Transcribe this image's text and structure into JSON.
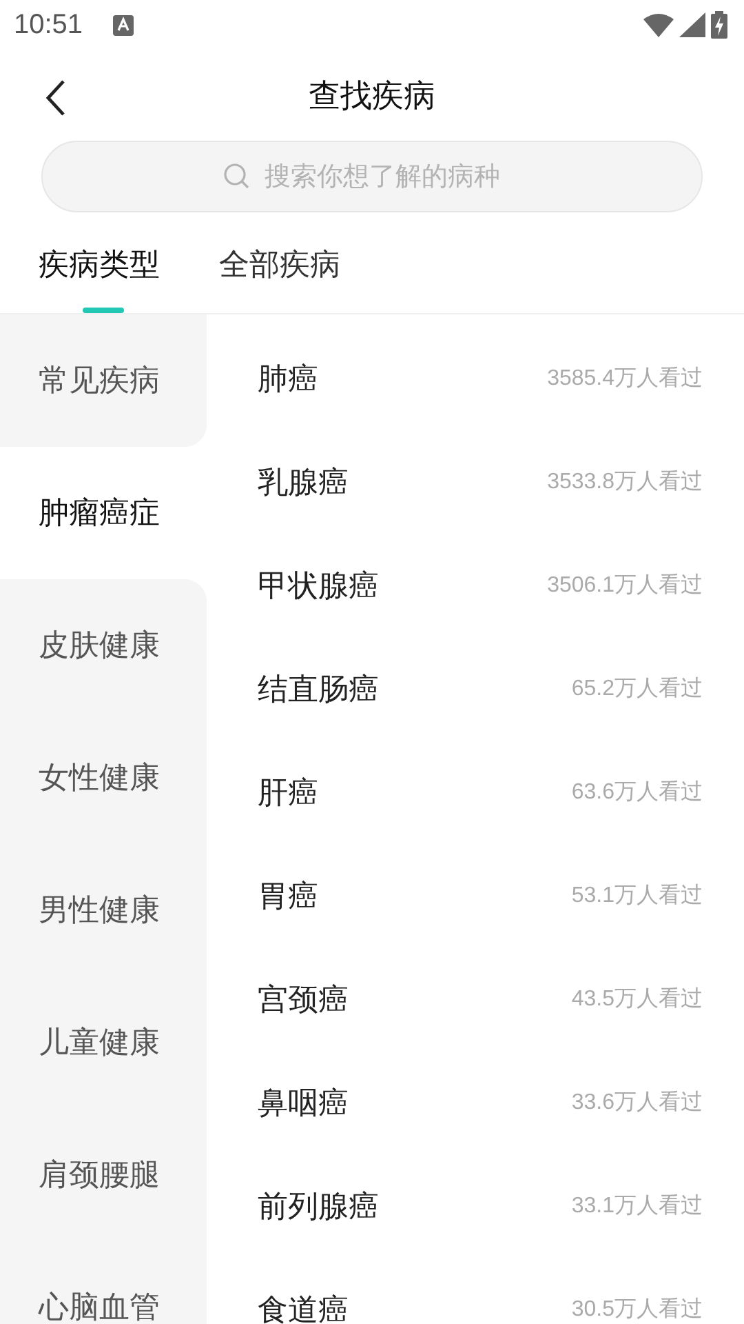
{
  "status_bar": {
    "time": "10:51"
  },
  "header": {
    "title": "查找疾病"
  },
  "search": {
    "placeholder": "搜索你想了解的病种"
  },
  "tabs": [
    {
      "label": "疾病类型",
      "selected": true
    },
    {
      "label": "全部疾病",
      "selected": false
    }
  ],
  "categories": [
    {
      "label": "常见疾病",
      "selected": false
    },
    {
      "label": "肿瘤癌症",
      "selected": true
    },
    {
      "label": "皮肤健康",
      "selected": false
    },
    {
      "label": "女性健康",
      "selected": false
    },
    {
      "label": "男性健康",
      "selected": false
    },
    {
      "label": "儿童健康",
      "selected": false
    },
    {
      "label": "肩颈腰腿",
      "selected": false
    },
    {
      "label": "心脑血管",
      "selected": false
    }
  ],
  "diseases": [
    {
      "name": "肺癌",
      "views": "3585.4万人看过"
    },
    {
      "name": "乳腺癌",
      "views": "3533.8万人看过"
    },
    {
      "name": "甲状腺癌",
      "views": "3506.1万人看过"
    },
    {
      "name": "结直肠癌",
      "views": "65.2万人看过"
    },
    {
      "name": "肝癌",
      "views": "63.6万人看过"
    },
    {
      "name": "胃癌",
      "views": "53.1万人看过"
    },
    {
      "name": "宫颈癌",
      "views": "43.5万人看过"
    },
    {
      "name": "鼻咽癌",
      "views": "33.6万人看过"
    },
    {
      "name": "前列腺癌",
      "views": "33.1万人看过"
    },
    {
      "name": "食道癌",
      "views": "30.5万人看过"
    }
  ]
}
